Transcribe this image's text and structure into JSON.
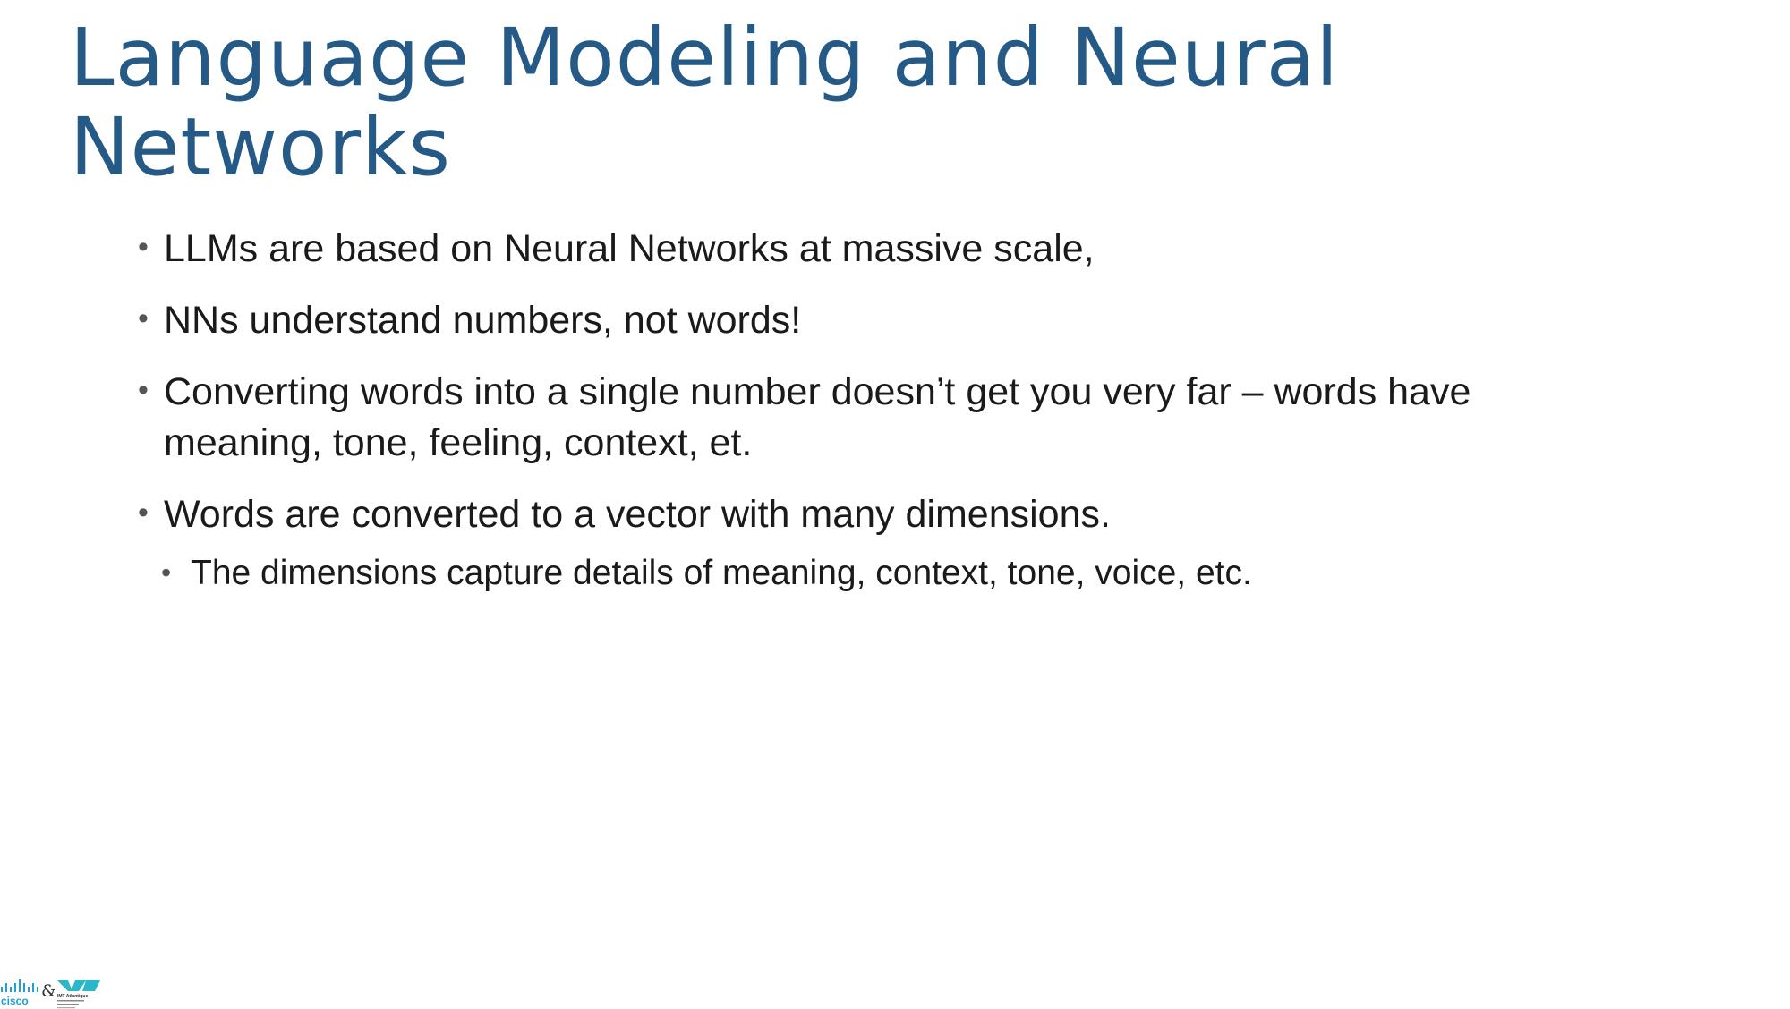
{
  "slide": {
    "title": "Language Modeling and Neural Networks",
    "bullets": [
      {
        "level": 1,
        "text": "LLMs are based on Neural Networks at massive scale,"
      },
      {
        "level": 1,
        "text": "NNs understand numbers, not words!"
      },
      {
        "level": 1,
        "text": "Converting words into a single number doesn’t get you very far – words have meaning, tone, feeling, context, et."
      },
      {
        "level": 1,
        "text": "Words are converted to a vector with many dimensions."
      },
      {
        "level": 2,
        "text": "The dimensions capture details of meaning, context, tone, voice, etc."
      }
    ]
  },
  "footer": {
    "logo_left": {
      "text": "cisco",
      "icon": "cisco-logo"
    },
    "separator": "&",
    "logo_right": {
      "text": "IMT Atlantique",
      "icon": "imt-atlantique-logo"
    }
  },
  "colors": {
    "title": "#255a86",
    "body_text": "#1a1a1a",
    "cisco_blue": "#1ba0d7",
    "imt_teal": "#2ab7c9"
  }
}
